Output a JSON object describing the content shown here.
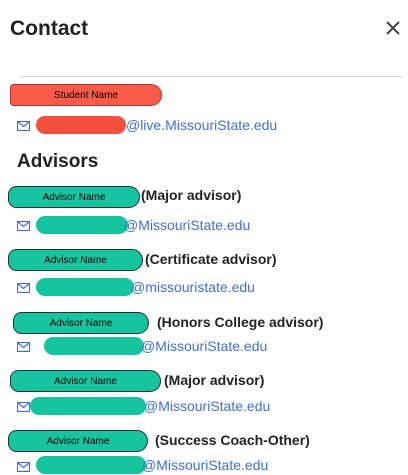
{
  "header": {
    "title": "Contact",
    "close_icon": "close-icon"
  },
  "student": {
    "name_label": "Student Name",
    "email_domain": "@live.MissouriState.edu"
  },
  "advisors_section": {
    "title": "Advisors"
  },
  "advisors": [
    {
      "name_label": "Advisor Name",
      "role": "(Major advisor)",
      "email_domain": "@MissouriState.edu"
    },
    {
      "name_label": "Advisor Name",
      "role": "(Certificate advisor)",
      "email_domain": "@missouristate.edu"
    },
    {
      "name_label": "Advisor Name",
      "role": "(Honors College advisor)",
      "email_domain": "@MissouriState.edu"
    },
    {
      "name_label": "Advisor Name",
      "role": "(Major advisor)",
      "email_domain": "@MissouriState.edu"
    },
    {
      "name_label": "Advisor Name",
      "role": "(Success Coach-Other)",
      "email_domain": "@MissouriState.edu"
    }
  ],
  "colors": {
    "student_highlight": "#f85c48",
    "advisor_highlight": "#17c4a0",
    "link": "#3f6fd1"
  }
}
